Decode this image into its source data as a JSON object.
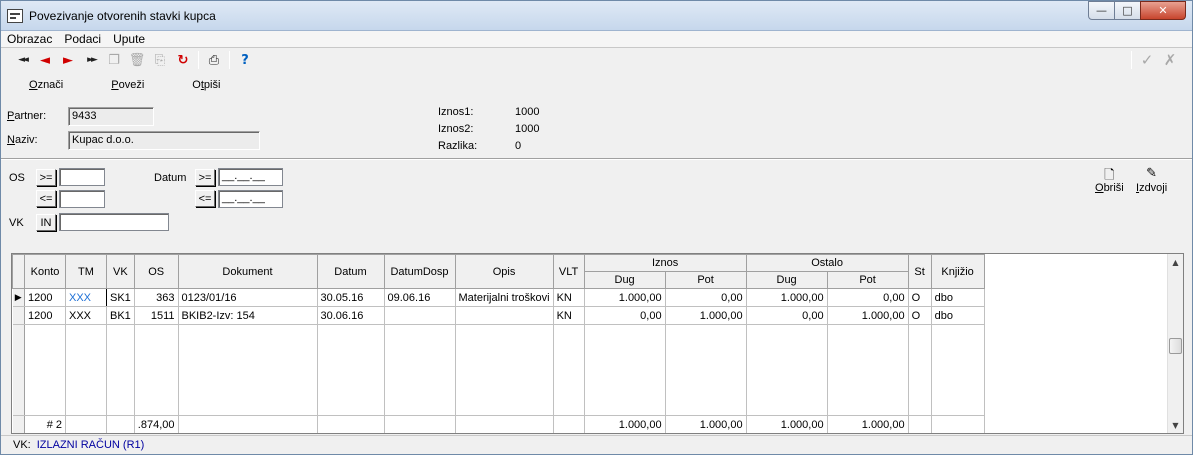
{
  "window": {
    "title": "Povezivanje otvorenih stavki kupca",
    "controls": {
      "minimize": "—",
      "maximize": "□",
      "close": "✕"
    }
  },
  "menu": [
    "Obrazac",
    "Podaci",
    "Upute"
  ],
  "toolbar": {
    "buttons": [
      {
        "name": "first-record-icon",
        "glyph": "◄◄",
        "style": "dark"
      },
      {
        "name": "previous-record-icon",
        "glyph": "◄",
        "style": "red"
      },
      {
        "name": "next-record-icon",
        "glyph": "►",
        "style": "red"
      },
      {
        "name": "last-record-icon",
        "glyph": "►►",
        "style": "dark"
      },
      {
        "name": "copy-record-icon",
        "glyph": "❐",
        "style": "gray"
      },
      {
        "name": "delete-record-icon",
        "glyph": "🗑",
        "style": "gray"
      },
      {
        "name": "duplicate-record-icon",
        "glyph": "⎘",
        "style": "gray"
      },
      {
        "name": "refresh-icon",
        "glyph": "↻",
        "style": "red"
      },
      {
        "name": "print-icon",
        "glyph": "⎙",
        "style": "dark"
      },
      {
        "name": "help-icon",
        "glyph": "?",
        "style": "blue"
      }
    ],
    "confirm_glyph": "✓",
    "cancel_glyph": "✗"
  },
  "actions": {
    "oznaci": {
      "u": "O",
      "rest": "znači"
    },
    "povezi": {
      "u": "P",
      "rest": "oveži"
    },
    "otpisi_pre": "O",
    "otpisi_u": "t",
    "otpisi_post": "piši"
  },
  "partner": {
    "label_u": "P",
    "label_rest": "artner:",
    "value": "9433",
    "naziv_label_u": "N",
    "naziv_label_rest": "aziv:",
    "naziv_value": "Kupac d.o.o."
  },
  "summary": [
    {
      "label": "Iznos1:",
      "value": "1000"
    },
    {
      "label": "Iznos2:",
      "value": "1000"
    },
    {
      "label": "Razlika:",
      "value": "0"
    }
  ],
  "filters": {
    "os_label": "OS",
    "ge": ">=",
    "le": "<=",
    "datum_label": "Datum",
    "date_placeholder": "__.__.__",
    "vk_label": "VK",
    "in_label": "IN"
  },
  "right_buttons": {
    "obrisi_u": "O",
    "obrisi_rest": "briši",
    "obrisi_icon": "🗋",
    "izdvoji_u": "I",
    "izdvoji_rest": "zdvoji",
    "izdvoji_icon": "✎"
  },
  "grid": {
    "headers": {
      "konto": "Konto",
      "tm": "TM",
      "vk": "VK",
      "os": "OS",
      "dokument": "Dokument",
      "datum": "Datum",
      "datumdosp": "DatumDosp",
      "opis": "Opis",
      "vlt": "VLT",
      "iznos": "Iznos",
      "ostalo": "Ostalo",
      "dug": "Dug",
      "pot": "Pot",
      "st": "St",
      "knjizio": "Knjižio"
    },
    "rows": [
      {
        "konto": "1200",
        "tm": "XXX",
        "vk": "SK1",
        "os": "363",
        "dokument": "0123/01/16",
        "datum": "30.05.16",
        "datumdosp": "09.06.16",
        "opis": "Materijalni troškovi",
        "vlt": "KN",
        "iznos_dug": "1.000,00",
        "iznos_pot": "0,00",
        "ostalo_dug": "1.000,00",
        "ostalo_pot": "0,00",
        "st": "O",
        "knjizio": "dbo"
      },
      {
        "konto": "1200",
        "tm": "XXX",
        "vk": "BK1",
        "os": "1511",
        "dokument": "BKIB2-Izv: 154",
        "datum": "30.06.16",
        "datumdosp": "",
        "opis": "",
        "vlt": "KN",
        "iznos_dug": "0,00",
        "iznos_pot": "1.000,00",
        "ostalo_dug": "0,00",
        "ostalo_pot": "1.000,00",
        "st": "O",
        "knjizio": "dbo"
      }
    ],
    "totals": {
      "count": "# 2",
      "os": ".874,00",
      "iznos_dug": "1.000,00",
      "iznos_pot": "1.000,00",
      "ostalo_dug": "1.000,00",
      "ostalo_pot": "1.000,00"
    },
    "current_row_marker": "▶"
  },
  "status": {
    "label": "VK:",
    "value": "IZLAZNI RAČUN (R1)"
  }
}
